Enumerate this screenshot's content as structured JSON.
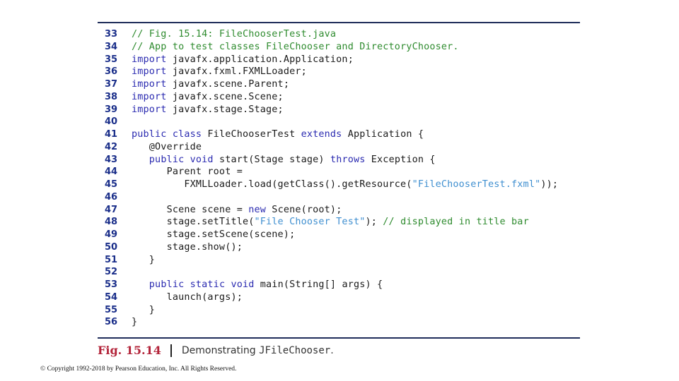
{
  "code": {
    "lines": [
      {
        "number": "33",
        "tokens": [
          {
            "t": "cm",
            "v": "// Fig. 15.14: FileChooserTest.java"
          }
        ]
      },
      {
        "number": "34",
        "tokens": [
          {
            "t": "cm",
            "v": "// App to test classes FileChooser and DirectoryChooser."
          }
        ]
      },
      {
        "number": "35",
        "tokens": [
          {
            "t": "kw",
            "v": "import"
          },
          {
            "t": "plain",
            "v": " javafx.application.Application;"
          }
        ]
      },
      {
        "number": "36",
        "tokens": [
          {
            "t": "kw",
            "v": "import"
          },
          {
            "t": "plain",
            "v": " javafx.fxml.FXMLLoader;"
          }
        ]
      },
      {
        "number": "37",
        "tokens": [
          {
            "t": "kw",
            "v": "import"
          },
          {
            "t": "plain",
            "v": " javafx.scene.Parent;"
          }
        ]
      },
      {
        "number": "38",
        "tokens": [
          {
            "t": "kw",
            "v": "import"
          },
          {
            "t": "plain",
            "v": " javafx.scene.Scene;"
          }
        ]
      },
      {
        "number": "39",
        "tokens": [
          {
            "t": "kw",
            "v": "import"
          },
          {
            "t": "plain",
            "v": " javafx.stage.Stage;"
          }
        ]
      },
      {
        "number": "40",
        "tokens": []
      },
      {
        "number": "41",
        "tokens": [
          {
            "t": "kw",
            "v": "public class"
          },
          {
            "t": "plain",
            "v": " FileChooserTest "
          },
          {
            "t": "kw",
            "v": "extends"
          },
          {
            "t": "plain",
            "v": " Application {"
          }
        ]
      },
      {
        "number": "42",
        "tokens": [
          {
            "t": "plain",
            "v": "   @Override"
          }
        ]
      },
      {
        "number": "43",
        "tokens": [
          {
            "t": "plain",
            "v": "   "
          },
          {
            "t": "kw",
            "v": "public void"
          },
          {
            "t": "plain",
            "v": " start(Stage stage) "
          },
          {
            "t": "kw",
            "v": "throws"
          },
          {
            "t": "plain",
            "v": " Exception {"
          }
        ]
      },
      {
        "number": "44",
        "tokens": [
          {
            "t": "plain",
            "v": "      Parent root ="
          }
        ]
      },
      {
        "number": "45",
        "tokens": [
          {
            "t": "plain",
            "v": "         FXMLLoader.load(getClass().getResource("
          },
          {
            "t": "str",
            "v": "\"FileChooserTest.fxml\""
          },
          {
            "t": "plain",
            "v": "));"
          }
        ]
      },
      {
        "number": "46",
        "tokens": []
      },
      {
        "number": "47",
        "tokens": [
          {
            "t": "plain",
            "v": "      Scene scene = "
          },
          {
            "t": "kw",
            "v": "new"
          },
          {
            "t": "plain",
            "v": " Scene(root);"
          }
        ]
      },
      {
        "number": "48",
        "tokens": [
          {
            "t": "plain",
            "v": "      stage.setTitle("
          },
          {
            "t": "str",
            "v": "\"File Chooser Test\""
          },
          {
            "t": "plain",
            "v": "); "
          },
          {
            "t": "cm",
            "v": "// displayed in title bar"
          }
        ]
      },
      {
        "number": "49",
        "tokens": [
          {
            "t": "plain",
            "v": "      stage.setScene(scene);"
          }
        ]
      },
      {
        "number": "50",
        "tokens": [
          {
            "t": "plain",
            "v": "      stage.show();"
          }
        ]
      },
      {
        "number": "51",
        "tokens": [
          {
            "t": "plain",
            "v": "   }"
          }
        ]
      },
      {
        "number": "52",
        "tokens": []
      },
      {
        "number": "53",
        "tokens": [
          {
            "t": "plain",
            "v": "   "
          },
          {
            "t": "kw",
            "v": "public static void"
          },
          {
            "t": "plain",
            "v": " main(String[] args) {"
          }
        ]
      },
      {
        "number": "54",
        "tokens": [
          {
            "t": "plain",
            "v": "      launch(args);"
          }
        ]
      },
      {
        "number": "55",
        "tokens": [
          {
            "t": "plain",
            "v": "   }"
          }
        ]
      },
      {
        "number": "56",
        "tokens": [
          {
            "t": "plain",
            "v": "}"
          }
        ]
      }
    ]
  },
  "caption": {
    "figure_label": "Fig. 15.14",
    "text": "Demonstrating ",
    "code_term": "JFileChooser",
    "period": "."
  },
  "footer": {
    "copyright": "© Copyright 1992-2018 by Pearson Education, Inc. All Rights Reserved."
  },
  "colors": {
    "keyword": "#2a2ab0",
    "comment": "#2e8b2e",
    "string": "#3f8fd0",
    "line_number": "#1b2f8a",
    "figure_label": "#b3243a",
    "rule": "#1f2d5a"
  }
}
